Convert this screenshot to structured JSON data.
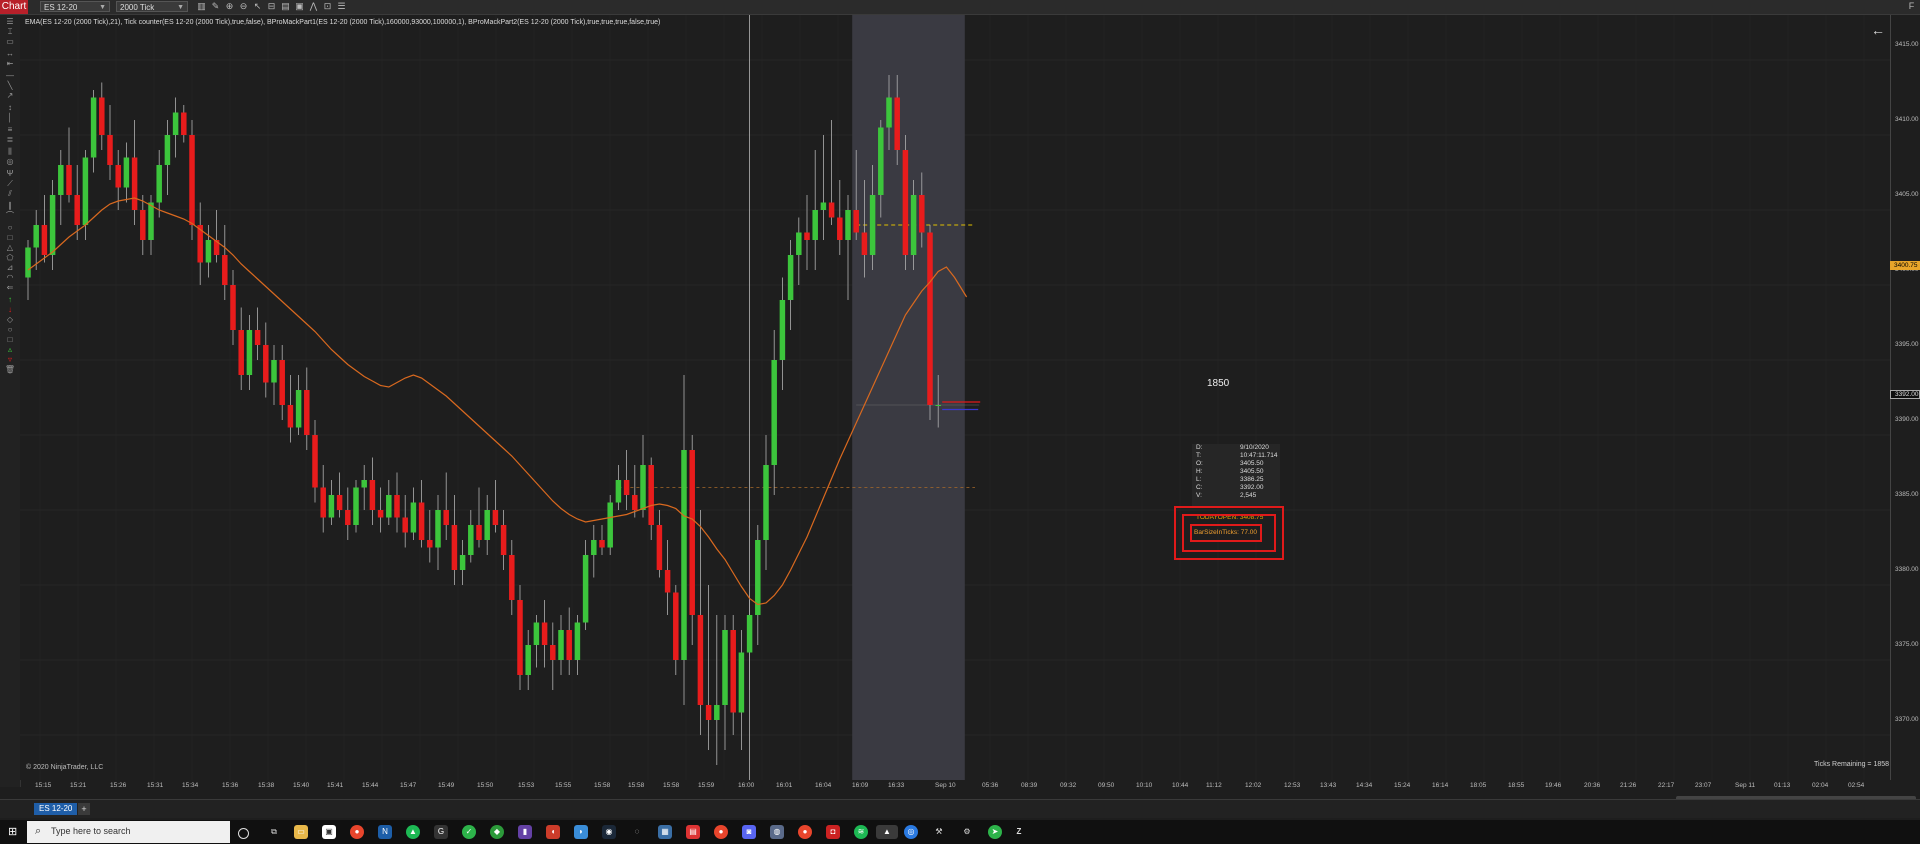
{
  "toolbar": {
    "chart_label": "Chart",
    "instrument": "ES 12-20",
    "interval": "2000 Tick"
  },
  "indicators_line": "EMA(ES 12-20 (2000 Tick),21), Tick counter(ES 12-20 (2000 Tick),true,false), BProMackPart1(ES 12-20 (2000 Tick),160000,93000,100000,1), BProMackPart2(ES 12-20 (2000 Tick),true,true,true,false,true)",
  "copyright": "© 2020 NinjaTrader, LLC",
  "ticks_remaining": "Ticks Remaining = 1858",
  "tick_counter_value": "1850",
  "current_price_badge": "3392.00",
  "top_price_badge": "3400.75",
  "price_axis": [
    "3415.00",
    "3410.00",
    "3405.00",
    "3400.00",
    "3395.00",
    "3390.00",
    "3385.00",
    "3380.00",
    "3375.00",
    "3370.00"
  ],
  "time_axis": [
    "15:15",
    "15:21",
    "15:26",
    "15:31",
    "15:34",
    "15:36",
    "15:38",
    "15:40",
    "15:41",
    "15:44",
    "15:47",
    "15:49",
    "15:50",
    "15:53",
    "15:55",
    "15:58",
    "15:58",
    "15:58",
    "15:59",
    "16:00",
    "16:01",
    "16:04",
    "16:09",
    "16:33",
    "Sep 10",
    "05:36",
    "08:39",
    "09:32",
    "09:50",
    "10:10",
    "10:44",
    "11:12",
    "12:02",
    "12:53",
    "13:43",
    "14:34",
    "15:24",
    "16:14",
    "18:05",
    "18:55",
    "19:46",
    "20:36",
    "21:26",
    "22:17",
    "23:07",
    "Sep 11",
    "01:13",
    "02:04",
    "02:54"
  ],
  "data_box": {
    "rows": [
      {
        "k": "D:",
        "v": "9/10/2020"
      },
      {
        "k": "T:",
        "v": "10:47:11.714"
      },
      {
        "k": "O:",
        "v": "3405.50"
      },
      {
        "k": "H:",
        "v": "3405.50"
      },
      {
        "k": "L:",
        "v": "3386.25"
      },
      {
        "k": "C:",
        "v": "3392.00"
      },
      {
        "k": "V:",
        "v": "2,545"
      }
    ],
    "today_open": "TODAYOPEN: 3408.75",
    "bar_size": "BarSizeInTicks: 77.00"
  },
  "bottom_tab": "ES 12-20",
  "taskbar": {
    "search_placeholder": "Type here to search"
  },
  "colors": {
    "up": "#3cc53c",
    "down": "#e81c1c",
    "ema": "#d9691f",
    "highlight": "#e01a1a",
    "accent_badge": "#e8a52a"
  },
  "chart_data": {
    "type": "candlestick",
    "title": "",
    "ylim": [
      3367,
      3417
    ],
    "candles": [
      {
        "o": 3400.5,
        "h": 3403,
        "l": 3399,
        "c": 3402.5
      },
      {
        "o": 3402.5,
        "h": 3405,
        "l": 3401,
        "c": 3404
      },
      {
        "o": 3404,
        "h": 3406,
        "l": 3401.5,
        "c": 3402
      },
      {
        "o": 3402,
        "h": 3407,
        "l": 3401,
        "c": 3406
      },
      {
        "o": 3406,
        "h": 3409,
        "l": 3404,
        "c": 3408
      },
      {
        "o": 3408,
        "h": 3410.5,
        "l": 3405.5,
        "c": 3406
      },
      {
        "o": 3406,
        "h": 3408,
        "l": 3403,
        "c": 3404
      },
      {
        "o": 3404,
        "h": 3409,
        "l": 3403,
        "c": 3408.5
      },
      {
        "o": 3408.5,
        "h": 3413,
        "l": 3407.5,
        "c": 3412.5
      },
      {
        "o": 3412.5,
        "h": 3413.5,
        "l": 3409,
        "c": 3410
      },
      {
        "o": 3410,
        "h": 3412,
        "l": 3407,
        "c": 3408
      },
      {
        "o": 3408,
        "h": 3409,
        "l": 3405,
        "c": 3406.5
      },
      {
        "o": 3406.5,
        "h": 3409.5,
        "l": 3405.5,
        "c": 3408.5
      },
      {
        "o": 3408.5,
        "h": 3411,
        "l": 3404,
        "c": 3405
      },
      {
        "o": 3405,
        "h": 3406,
        "l": 3402,
        "c": 3403
      },
      {
        "o": 3403,
        "h": 3406,
        "l": 3402,
        "c": 3405.5
      },
      {
        "o": 3405.5,
        "h": 3409,
        "l": 3404.5,
        "c": 3408
      },
      {
        "o": 3408,
        "h": 3411,
        "l": 3406,
        "c": 3410
      },
      {
        "o": 3410,
        "h": 3412.5,
        "l": 3408.5,
        "c": 3411.5
      },
      {
        "o": 3411.5,
        "h": 3412,
        "l": 3409.5,
        "c": 3410
      },
      {
        "o": 3410,
        "h": 3411,
        "l": 3403,
        "c": 3404
      },
      {
        "o": 3404,
        "h": 3405.5,
        "l": 3400,
        "c": 3401.5
      },
      {
        "o": 3401.5,
        "h": 3404,
        "l": 3400.5,
        "c": 3403
      },
      {
        "o": 3403,
        "h": 3405,
        "l": 3401.5,
        "c": 3402
      },
      {
        "o": 3402,
        "h": 3404,
        "l": 3399,
        "c": 3400
      },
      {
        "o": 3400,
        "h": 3401,
        "l": 3396,
        "c": 3397
      },
      {
        "o": 3397,
        "h": 3398.5,
        "l": 3393,
        "c": 3394
      },
      {
        "o": 3394,
        "h": 3398,
        "l": 3393,
        "c": 3397
      },
      {
        "o": 3397,
        "h": 3398.5,
        "l": 3395,
        "c": 3396
      },
      {
        "o": 3396,
        "h": 3397.5,
        "l": 3392.5,
        "c": 3393.5
      },
      {
        "o": 3393.5,
        "h": 3396,
        "l": 3392,
        "c": 3395
      },
      {
        "o": 3395,
        "h": 3396,
        "l": 3391,
        "c": 3392
      },
      {
        "o": 3392,
        "h": 3394,
        "l": 3389.5,
        "c": 3390.5
      },
      {
        "o": 3390.5,
        "h": 3394,
        "l": 3390,
        "c": 3393
      },
      {
        "o": 3393,
        "h": 3394.5,
        "l": 3389,
        "c": 3390
      },
      {
        "o": 3390,
        "h": 3391,
        "l": 3385.5,
        "c": 3386.5
      },
      {
        "o": 3386.5,
        "h": 3388,
        "l": 3383.5,
        "c": 3384.5
      },
      {
        "o": 3384.5,
        "h": 3387,
        "l": 3384,
        "c": 3386
      },
      {
        "o": 3386,
        "h": 3387.5,
        "l": 3384.5,
        "c": 3385
      },
      {
        "o": 3385,
        "h": 3386.5,
        "l": 3383,
        "c": 3384
      },
      {
        "o": 3384,
        "h": 3387,
        "l": 3383.5,
        "c": 3386.5
      },
      {
        "o": 3386.5,
        "h": 3388,
        "l": 3385,
        "c": 3387
      },
      {
        "o": 3387,
        "h": 3388.5,
        "l": 3384,
        "c": 3385
      },
      {
        "o": 3385,
        "h": 3386.5,
        "l": 3383.5,
        "c": 3384.5
      },
      {
        "o": 3384.5,
        "h": 3387,
        "l": 3384,
        "c": 3386
      },
      {
        "o": 3386,
        "h": 3387.5,
        "l": 3383.5,
        "c": 3384.5
      },
      {
        "o": 3384.5,
        "h": 3386,
        "l": 3382.5,
        "c": 3383.5
      },
      {
        "o": 3383.5,
        "h": 3386.5,
        "l": 3383,
        "c": 3385.5
      },
      {
        "o": 3385.5,
        "h": 3387,
        "l": 3382.5,
        "c": 3383
      },
      {
        "o": 3383,
        "h": 3385,
        "l": 3381.5,
        "c": 3382.5
      },
      {
        "o": 3382.5,
        "h": 3386,
        "l": 3381,
        "c": 3385
      },
      {
        "o": 3385,
        "h": 3387.5,
        "l": 3383,
        "c": 3384
      },
      {
        "o": 3384,
        "h": 3386,
        "l": 3380,
        "c": 3381
      },
      {
        "o": 3381,
        "h": 3383,
        "l": 3380,
        "c": 3382
      },
      {
        "o": 3382,
        "h": 3385,
        "l": 3381.5,
        "c": 3384
      },
      {
        "o": 3384,
        "h": 3386.5,
        "l": 3382.5,
        "c": 3383
      },
      {
        "o": 3383,
        "h": 3386,
        "l": 3382,
        "c": 3385
      },
      {
        "o": 3385,
        "h": 3387,
        "l": 3383.5,
        "c": 3384
      },
      {
        "o": 3384,
        "h": 3385,
        "l": 3381,
        "c": 3382
      },
      {
        "o": 3382,
        "h": 3383,
        "l": 3378,
        "c": 3379
      },
      {
        "o": 3379,
        "h": 3380,
        "l": 3373,
        "c": 3374
      },
      {
        "o": 3374,
        "h": 3377,
        "l": 3373,
        "c": 3376
      },
      {
        "o": 3376,
        "h": 3378,
        "l": 3374.5,
        "c": 3377.5
      },
      {
        "o": 3377.5,
        "h": 3379,
        "l": 3374.5,
        "c": 3376
      },
      {
        "o": 3376,
        "h": 3377.5,
        "l": 3373,
        "c": 3375
      },
      {
        "o": 3375,
        "h": 3378,
        "l": 3374,
        "c": 3377
      },
      {
        "o": 3377,
        "h": 3378.5,
        "l": 3374,
        "c": 3375
      },
      {
        "o": 3375,
        "h": 3378,
        "l": 3374,
        "c": 3377.5
      },
      {
        "o": 3377.5,
        "h": 3383,
        "l": 3377,
        "c": 3382
      },
      {
        "o": 3382,
        "h": 3384,
        "l": 3380.5,
        "c": 3383
      },
      {
        "o": 3383,
        "h": 3384,
        "l": 3382,
        "c": 3382.5
      },
      {
        "o": 3382.5,
        "h": 3386,
        "l": 3382,
        "c": 3385.5
      },
      {
        "o": 3385.5,
        "h": 3388,
        "l": 3385,
        "c": 3387
      },
      {
        "o": 3387,
        "h": 3389,
        "l": 3385,
        "c": 3386
      },
      {
        "o": 3386,
        "h": 3388,
        "l": 3384.5,
        "c": 3385
      },
      {
        "o": 3385,
        "h": 3390,
        "l": 3384.5,
        "c": 3388
      },
      {
        "o": 3388,
        "h": 3388.5,
        "l": 3383,
        "c": 3384
      },
      {
        "o": 3384,
        "h": 3385,
        "l": 3380.5,
        "c": 3381
      },
      {
        "o": 3381,
        "h": 3383,
        "l": 3378,
        "c": 3379.5
      },
      {
        "o": 3379.5,
        "h": 3380,
        "l": 3374,
        "c": 3375
      },
      {
        "o": 3375,
        "h": 3394,
        "l": 3372,
        "c": 3389
      },
      {
        "o": 3389,
        "h": 3390,
        "l": 3376,
        "c": 3378
      },
      {
        "o": 3378,
        "h": 3385,
        "l": 3370,
        "c": 3372
      },
      {
        "o": 3372,
        "h": 3380,
        "l": 3369,
        "c": 3371
      },
      {
        "o": 3371,
        "h": 3378,
        "l": 3368,
        "c": 3372
      },
      {
        "o": 3372,
        "h": 3378,
        "l": 3369,
        "c": 3377
      },
      {
        "o": 3377,
        "h": 3378,
        "l": 3370,
        "c": 3371.5
      },
      {
        "o": 3371.5,
        "h": 3377,
        "l": 3369,
        "c": 3375.5
      },
      {
        "o": 3375.5,
        "h": 3379,
        "l": 3373,
        "c": 3378
      },
      {
        "o": 3378,
        "h": 3384,
        "l": 3376,
        "c": 3383
      },
      {
        "o": 3383,
        "h": 3390,
        "l": 3381,
        "c": 3388
      },
      {
        "o": 3388,
        "h": 3397,
        "l": 3386,
        "c": 3395
      },
      {
        "o": 3395,
        "h": 3400.5,
        "l": 3393,
        "c": 3399
      },
      {
        "o": 3399,
        "h": 3403,
        "l": 3397,
        "c": 3402
      },
      {
        "o": 3402,
        "h": 3404.5,
        "l": 3400,
        "c": 3403.5
      },
      {
        "o": 3403.5,
        "h": 3406,
        "l": 3401,
        "c": 3403
      },
      {
        "o": 3403,
        "h": 3409,
        "l": 3401,
        "c": 3405
      },
      {
        "o": 3405,
        "h": 3410,
        "l": 3403,
        "c": 3405.5
      },
      {
        "o": 3405.5,
        "h": 3411,
        "l": 3404,
        "c": 3404.5
      },
      {
        "o": 3404.5,
        "h": 3407,
        "l": 3402,
        "c": 3403
      },
      {
        "o": 3403,
        "h": 3406,
        "l": 3399,
        "c": 3405
      },
      {
        "o": 3405,
        "h": 3409,
        "l": 3403,
        "c": 3403.5
      },
      {
        "o": 3403.5,
        "h": 3407,
        "l": 3400.5,
        "c": 3402
      },
      {
        "o": 3402,
        "h": 3408,
        "l": 3401,
        "c": 3406
      },
      {
        "o": 3406,
        "h": 3411,
        "l": 3404.5,
        "c": 3410.5
      },
      {
        "o": 3410.5,
        "h": 3414,
        "l": 3409,
        "c": 3412.5
      },
      {
        "o": 3412.5,
        "h": 3414,
        "l": 3408,
        "c": 3409
      },
      {
        "o": 3409,
        "h": 3410,
        "l": 3401,
        "c": 3402
      },
      {
        "o": 3402,
        "h": 3407,
        "l": 3401,
        "c": 3406
      },
      {
        "o": 3406,
        "h": 3407.5,
        "l": 3402.5,
        "c": 3403.5
      },
      {
        "o": 3403.5,
        "h": 3404,
        "l": 3391,
        "c": 3392
      },
      {
        "o": 3392,
        "h": 3394,
        "l": 3390.5,
        "c": 3392
      }
    ],
    "ema": [
      3401,
      3401.4,
      3401.8,
      3402.2,
      3402.7,
      3403.2,
      3403.6,
      3404,
      3404.5,
      3405,
      3405.4,
      3405.6,
      3405.7,
      3405.8,
      3405.6,
      3405.3,
      3405,
      3404.8,
      3404.6,
      3404.4,
      3404.1,
      3403.7,
      3403.3,
      3402.9,
      3402.5,
      3402,
      3401.4,
      3400.9,
      3400.4,
      3399.9,
      3399.4,
      3398.9,
      3398.4,
      3397.9,
      3397.4,
      3396.9,
      3396.3,
      3395.7,
      3395.2,
      3394.7,
      3394.3,
      3393.9,
      3393.6,
      3393.3,
      3393.2,
      3393.5,
      3393.8,
      3394,
      3393.8,
      3393.4,
      3393,
      3392.6,
      3392.1,
      3391.6,
      3391.1,
      3390.6,
      3390.1,
      3389.6,
      3389.1,
      3388.6,
      3388,
      3387.4,
      3386.8,
      3386.2,
      3385.6,
      3385.1,
      3384.7,
      3384.4,
      3384.2,
      3384.3,
      3384.4,
      3384.5,
      3384.6,
      3384.7,
      3384.9,
      3385.1,
      3385.3,
      3385.4,
      3385.3,
      3385.1,
      3384.6,
      3384.4,
      3383.9,
      3383.2,
      3382.4,
      3381.7,
      3380.8,
      3379.9,
      3379.1,
      3378.7,
      3378.8,
      3379.3,
      3380,
      3381,
      3382.1,
      3383.2,
      3384.5,
      3385.8,
      3387.1,
      3388.4,
      3389.6,
      3390.8,
      3392,
      3393.2,
      3394.4,
      3395.6,
      3396.8,
      3398,
      3398.8,
      3399.6,
      3400.2,
      3400.9,
      3401.2,
      3400.5
    ]
  }
}
